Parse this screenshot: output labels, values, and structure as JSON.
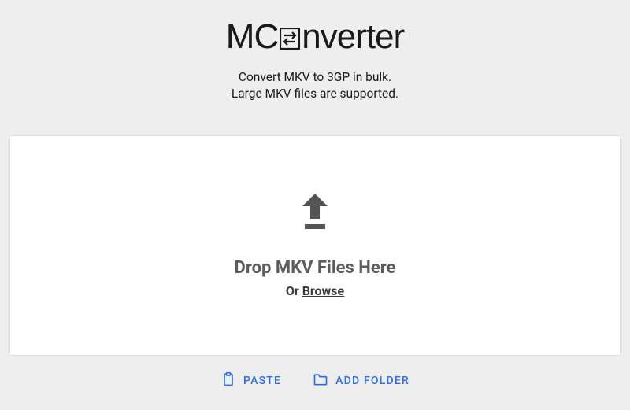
{
  "logo": {
    "part_1": "MC",
    "part_2": "nverter"
  },
  "subtitle": {
    "line_1": "Convert MKV to 3GP in bulk.",
    "line_2": "Large MKV files are supported."
  },
  "dropzone": {
    "title": "Drop MKV Files Here",
    "or_text": "Or ",
    "browse_text": "Browse"
  },
  "actions": {
    "paste_label": "PASTE",
    "add_folder_label": "ADD FOLDER"
  }
}
